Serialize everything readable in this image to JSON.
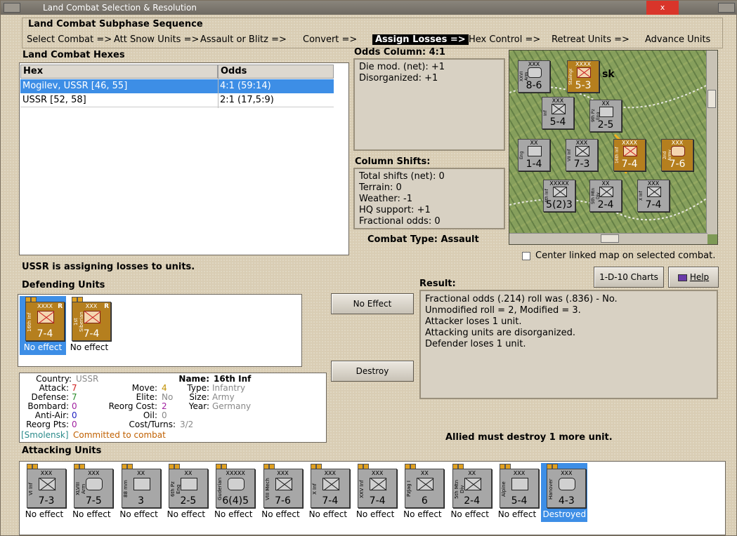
{
  "window": {
    "title": "Land Combat Selection & Resolution",
    "close_label": "x"
  },
  "subphase": {
    "title": "Land Combat Subphase Sequence",
    "steps": [
      "Select Combat =>",
      "Att Snow Units =>",
      "Assault or Blitz =>",
      "Convert =>",
      "Assign Losses =>",
      "Hex Control =>",
      "Retreat Units =>",
      "Advance Units"
    ],
    "active_step": "Assign Losses =>"
  },
  "hexes": {
    "title": "Land Combat Hexes",
    "col_hex": "Hex",
    "col_odds": "Odds",
    "rows": [
      {
        "hex": "Mogilev, USSR [46, 55]",
        "odds": "4:1 (59:14)",
        "selected": true
      },
      {
        "hex": "USSR [52, 58]",
        "odds": "2:1 (17,5:9)",
        "selected": false
      }
    ]
  },
  "odds": {
    "title": "Odds Column: 4:1",
    "lines": [
      "Die mod. (net): +1",
      "Disorganized: +1"
    ]
  },
  "shifts": {
    "title": "Column Shifts:",
    "lines": [
      "Total shifts (net): 0",
      "Terrain: 0",
      "Weather: -1",
      "HQ support: +1",
      "Fractional odds: 0"
    ]
  },
  "combat_type": "Combat Type:  Assault",
  "center_map_label": "Center linked map on selected combat.",
  "status_line": "USSR is assigning losses to units.",
  "charts_button": "1-D-10 Charts",
  "help_button": "Help",
  "defending": {
    "title": "Defending Units",
    "units": [
      {
        "name": "16th Inf",
        "size": "XXXX",
        "strength": "7-4",
        "status": "No effect",
        "selected": true
      },
      {
        "name": "1st Siberian",
        "size": "XXX",
        "strength": "7-4",
        "status": "No effect",
        "selected": false
      }
    ]
  },
  "no_effect_button": "No Effect",
  "destroy_button": "Destroy",
  "result": {
    "title": "Result:",
    "lines": [
      "Fractional odds (.214) roll was (.836)  - No.",
      "Unmodified roll = 2, Modified = 3.",
      "Attacker loses 1 unit.",
      "Attacking units are disorganized.",
      "Defender loses 1 unit."
    ],
    "footer": "Allied must destroy 1 more unit."
  },
  "unit_info": {
    "country_k": "Country:",
    "country_v": "USSR",
    "attack_k": "Attack:",
    "attack_v": "7",
    "defense_k": "Defense:",
    "defense_v": "7",
    "bombard_k": "Bombard:",
    "bombard_v": "0",
    "antiair_k": "Anti-Air:",
    "antiair_v": "0",
    "reorgpts_k": "Reorg Pts:",
    "reorgpts_v": "0",
    "move_k": "Move:",
    "move_v": "4",
    "elite_k": "Elite:",
    "elite_v": "No",
    "reorgcost_k": "Reorg Cost:",
    "reorgcost_v": "2",
    "oil_k": "Oil:",
    "oil_v": "0",
    "costturns_k": "Cost/Turns:",
    "costturns_v": "3/2",
    "name_k": "Name:",
    "name_v": "16th Inf",
    "type_k": "Type:",
    "type_v": "Infantry",
    "sizeu_k": "Size:",
    "sizeu_v": "Army",
    "year_k": "Year:",
    "year_v": "Germany",
    "location": "[Smolensk]",
    "committed": "Committed to combat"
  },
  "attacking": {
    "title": "Attacking Units",
    "units": [
      {
        "name": "VI Inf",
        "size": "XXX",
        "strength": "7-3",
        "status": "No effect",
        "selected": false
      },
      {
        "name": "XLVIII Arm",
        "size": "XXX",
        "strength": "7-5",
        "status": "No effect",
        "selected": false
      },
      {
        "name": "88 mm",
        "size": "XX",
        "strength": "3",
        "status": "No effect",
        "selected": false
      },
      {
        "name": "6th Pz Eng",
        "size": "XX",
        "strength": "2-5",
        "status": "No effect",
        "selected": false
      },
      {
        "name": "Guderian",
        "size": "XXXXX",
        "strength": "6(4)5",
        "status": "No effect",
        "selected": false
      },
      {
        "name": "VIII Mech",
        "size": "XXX",
        "strength": "7-6",
        "status": "No effect",
        "selected": false
      },
      {
        "name": "X Inf",
        "size": "XXX",
        "strength": "7-4",
        "status": "No effect",
        "selected": false
      },
      {
        "name": "XXV Inf",
        "size": "XXX",
        "strength": "7-4",
        "status": "No effect",
        "selected": false
      },
      {
        "name": "PzJag I",
        "size": "XX",
        "strength": "6",
        "status": "No effect",
        "selected": false
      },
      {
        "name": "5th Mtn Div",
        "size": "XX",
        "strength": "2-4",
        "status": "No effect",
        "selected": false
      },
      {
        "name": "Alpine",
        "size": "XXX",
        "strength": "5-4",
        "status": "No effect",
        "selected": false
      },
      {
        "name": "Hanover",
        "size": "XXX",
        "strength": "4-3",
        "status": "Destroyed",
        "selected": true
      }
    ]
  },
  "map": {
    "city_fragment": "sk",
    "counters": [
      {
        "name": "XXVI Arm",
        "size": "XXX",
        "strength": "8-6",
        "color": "grey"
      },
      {
        "name": "Stalingrad",
        "size": "XXXX",
        "strength": "5-3",
        "color": "brown"
      },
      {
        "name": "Inf",
        "size": "XXX",
        "strength": "5-4",
        "color": "grey"
      },
      {
        "name": "9th Pz Eng",
        "size": "XX",
        "strength": "2-5",
        "color": "grey"
      },
      {
        "name": "Eng",
        "size": "XX",
        "strength": "1-4",
        "color": "grey"
      },
      {
        "name": "VII Inf",
        "size": "XXX",
        "strength": "7-3",
        "color": "grey"
      },
      {
        "name": "16th Inf",
        "size": "XXXX",
        "strength": "7-4",
        "color": "brown"
      },
      {
        "name": "2nd Army",
        "size": "XXX",
        "strength": "7-6",
        "color": "brown"
      },
      {
        "name": "4th Inf",
        "size": "XXXXX",
        "strength": "5(2)3",
        "color": "grey"
      },
      {
        "name": "5th Mtn Div",
        "size": "XX",
        "strength": "2-4",
        "color": "grey"
      },
      {
        "name": "X Inf",
        "size": "XXX",
        "strength": "7-4",
        "color": "grey"
      }
    ]
  }
}
